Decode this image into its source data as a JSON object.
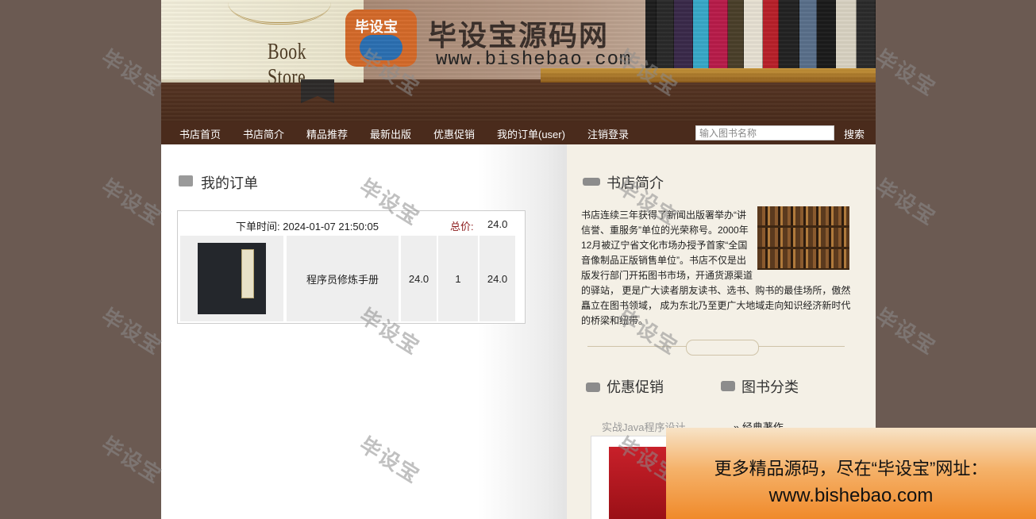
{
  "header": {
    "book_title": "Book Store",
    "brand_name": "毕设宝源码网",
    "brand_url": "www.bishebao.com",
    "logo_text": "毕设宝"
  },
  "nav": {
    "items": [
      "书店首页",
      "书店简介",
      "精品推荐",
      "最新出版",
      "优惠促销",
      "我的订单(user)",
      "注销登录"
    ],
    "search_placeholder": "输入图书名称",
    "search_label": "搜索"
  },
  "orders": {
    "title": "我的订单",
    "time_label": "下单时间: 2024-01-07 21:50:05",
    "total_label": "总价:",
    "total": "24.0",
    "items": [
      {
        "name": "程序员修炼手册",
        "price": "24.0",
        "quantity": "1",
        "subtotal": "24.0"
      }
    ]
  },
  "sidebar": {
    "intro_title": "书店简介",
    "intro_text": "书店连续三年获得了新闻出版署举办“讲信誉、重服务”单位的光荣称号。2000年12月被辽宁省文化市场办授予首家“全国音像制品正版销售单位”。书店不仅是出版发行部门开拓图书市场，开通货源渠道的驿站， 更是广大读者朋友读书、选书、购书的最佳场所，傲然矗立在图书领域， 成为东北乃至更广大地域走向知识经济新时代的桥梁和纽带。",
    "promo_title": "优惠促销",
    "category_title": "图书分类",
    "promo_item": "实战Java程序设计",
    "category_item": "经典著作"
  },
  "watermark": "毕设宝",
  "banner": {
    "line1": "更多精品源码，尽在“毕设宝”网址：",
    "line2": "www.bishebao.com"
  }
}
